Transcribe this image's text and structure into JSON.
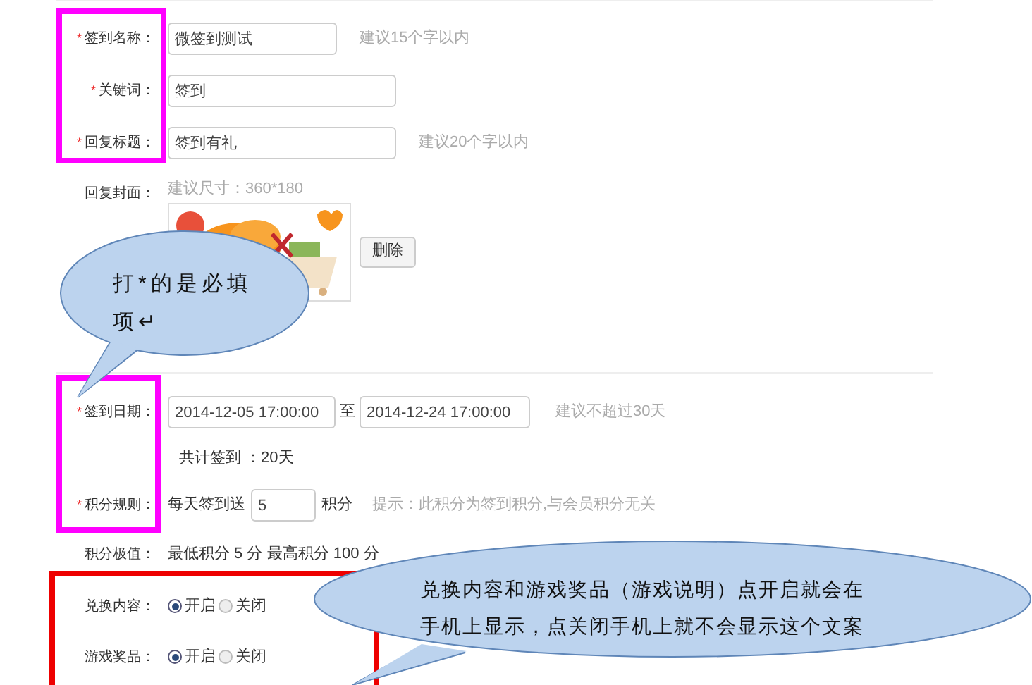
{
  "rows": [
    {
      "kind": "text",
      "label": "签到名称：",
      "mark": "*",
      "value": "微签到测试",
      "hint": "建议15个字以内"
    },
    {
      "kind": "text",
      "label": "关键词：",
      "mark": "*",
      "value": "签到"
    },
    {
      "kind": "text",
      "label": "回复标题：",
      "mark": "*",
      "value": "签到有礼",
      "hint": "建议20个字以内"
    },
    {
      "kind": "cover",
      "label": "回复封面：",
      "hint": "建议尺寸：360*180",
      "button": "删除"
    },
    {
      "kind": "date_range",
      "label": "签到日期：",
      "mark": "*",
      "start": "2014-12-05 17:00:00",
      "separator": "至",
      "end": "2014-12-24 17:00:00",
      "hint": "建议不超过30天"
    },
    {
      "kind": "note",
      "text": "共计签到 ：20天"
    },
    {
      "kind": "points",
      "label": "积分规则：",
      "mark": "*",
      "prefix": "每天签到送",
      "value": "5",
      "suffix": "积分",
      "hint": "提示：此积分为签到积分,与会员积分无关"
    },
    {
      "kind": "static",
      "label": "积分极值：",
      "text": "最低积分 5 分 最高积分 100 分"
    },
    {
      "kind": "radio",
      "label": "兑换内容：",
      "options": [
        {
          "label": "开启",
          "selected": true
        },
        {
          "label": "关闭",
          "selected": false
        }
      ]
    },
    {
      "kind": "radio",
      "label": "游戏奖品：",
      "options": [
        {
          "label": "开启",
          "selected": true
        },
        {
          "label": "关闭",
          "selected": false
        }
      ]
    }
  ],
  "highlight_boxes": [
    {
      "color": "#ff00ff"
    },
    {
      "color": "#ff00ff"
    },
    {
      "color": "#ee0000"
    }
  ],
  "callouts": [
    {
      "lines": [
        "打*的是必填",
        "项↵"
      ]
    },
    {
      "lines": [
        "兑换内容和游戏奖品（游戏说明）点开启就会在",
        "手机上显示，点关闭手机上就不会显示这个文案"
      ]
    }
  ]
}
